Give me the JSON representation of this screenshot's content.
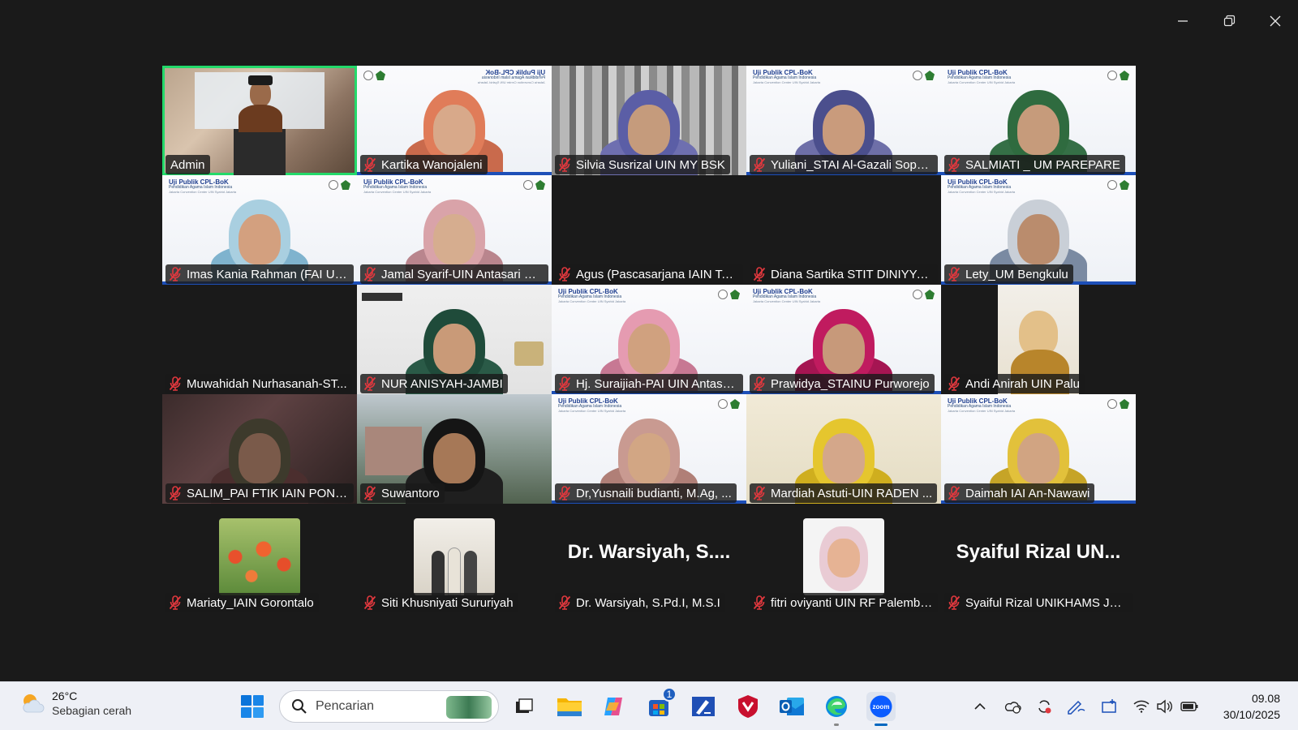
{
  "window": {
    "controls": {
      "minimize_icon": "minimize-icon",
      "restore_icon": "restore-icon",
      "close_icon": "close-icon"
    }
  },
  "participants": [
    {
      "name": "Admin",
      "muted": false,
      "active_speaker": true,
      "video": "stage"
    },
    {
      "name": "Kartika Wanojaleni",
      "muted": true,
      "video": "white-mirrored"
    },
    {
      "name": "Silvia Susrizal UIN MY BSK",
      "muted": true,
      "video": "curtain"
    },
    {
      "name": "Yuliani_STAI Al-Gazali Sopp...",
      "muted": true,
      "video": "white"
    },
    {
      "name": "SALMIATI _ UM PAREPARE",
      "muted": true,
      "video": "white"
    },
    {
      "name": "Imas Kania Rahman (FAI UIK...",
      "muted": true,
      "video": "white"
    },
    {
      "name": "Jamal Syarif-UIN Antasari Ba...",
      "muted": true,
      "video": "white"
    },
    {
      "name": "Agus (Pascasarjana IAIN Ter...",
      "muted": true,
      "video": "off"
    },
    {
      "name": "Diana Sartika STIT DINIYYAH...",
      "muted": true,
      "video": "off"
    },
    {
      "name": "Lety_UM Bengkulu",
      "muted": true,
      "video": "white"
    },
    {
      "name": "Muwahidah Nurhasanah-ST...",
      "muted": true,
      "video": "off"
    },
    {
      "name": "NUR ANISYAH-JAMBI",
      "muted": true,
      "video": "room"
    },
    {
      "name": "Hj. Suraijiah-PAI UIN Antasa...",
      "muted": true,
      "video": "white"
    },
    {
      "name": "Prawidya_STAINU Purworejo",
      "muted": true,
      "video": "white"
    },
    {
      "name": "Andi Anirah UIN Palu",
      "muted": true,
      "video": "narrow"
    },
    {
      "name": "SALIM_PAI FTIK IAIN PONTI...",
      "muted": true,
      "video": "dark"
    },
    {
      "name": "Suwantoro",
      "muted": true,
      "video": "city"
    },
    {
      "name": "Dr,Yusnaili budianti, M.Ag, ...",
      "muted": true,
      "video": "white"
    },
    {
      "name": "Mardiah Astuti-UIN RADEN ...",
      "muted": true,
      "video": "cream"
    },
    {
      "name": "Daimah IAI An-Nawawi",
      "muted": true,
      "video": "white"
    },
    {
      "name": "Mariaty_IAIN Gorontalo",
      "muted": true,
      "video": "photo-flowers"
    },
    {
      "name": "Siti Khusniyati Sururiyah",
      "muted": true,
      "video": "photo-group"
    },
    {
      "name": "Dr. Warsiyah, S.Pd.I, M.S.I",
      "muted": true,
      "video": "name-only",
      "display_name": "Dr. Warsiyah, S...."
    },
    {
      "name": "fitri oviyanti UIN RF Palemba...",
      "muted": true,
      "video": "photo-portrait"
    },
    {
      "name": "Syaiful Rizal UNIKHAMS Jem...",
      "muted": true,
      "video": "name-only",
      "display_name": "Syaiful Rizal UN..."
    }
  ],
  "brand_overlay": {
    "line1": "Uji Publik CPL-BoK",
    "line2": "Pendidikan Agama Islam Indonesia",
    "line3": "Jakarta Convention Center UIN Syahid Jakarta"
  },
  "taskbar": {
    "weather": {
      "temp": "26°C",
      "condition": "Sebagian cerah",
      "icon": "partly-sunny-icon"
    },
    "search_placeholder": "Pencarian",
    "apps": [
      {
        "name": "start",
        "icon": "windows-start-icon"
      },
      {
        "name": "task-view",
        "icon": "task-view-icon"
      },
      {
        "name": "file-explorer",
        "icon": "folder-icon"
      },
      {
        "name": "copilot",
        "icon": "copilot-icon"
      },
      {
        "name": "store",
        "icon": "store-icon",
        "badge": "1"
      },
      {
        "name": "app-a",
        "icon": "pen-app-icon"
      },
      {
        "name": "mcafee",
        "icon": "shield-app-icon"
      },
      {
        "name": "outlook",
        "icon": "outlook-icon"
      },
      {
        "name": "edge",
        "icon": "edge-icon"
      },
      {
        "name": "zoom",
        "icon": "zoom-icon",
        "label": "zoom"
      }
    ],
    "tray": [
      "chevron-up-icon",
      "onedrive-icon",
      "sync-icon",
      "pen-tray-icon",
      "display-tray-icon",
      "wifi-icon",
      "volume-icon",
      "battery-icon"
    ],
    "time": "09.08",
    "date": "30/10/2025"
  },
  "colors": {
    "speaker_border": "#23d96a",
    "mute_red": "#e0383e",
    "taskbar": "#eef0f6",
    "bg": "#1a1a1a"
  }
}
